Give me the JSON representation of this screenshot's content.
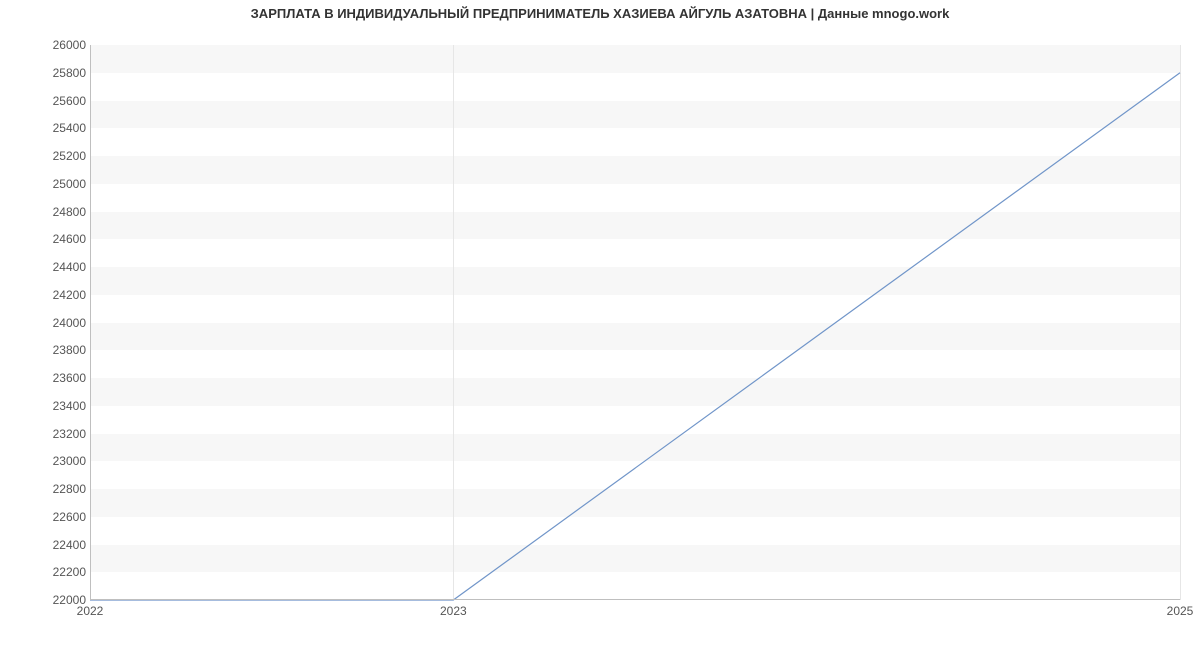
{
  "chart_data": {
    "type": "line",
    "title": "ЗАРПЛАТА В ИНДИВИДУАЛЬНЫЙ ПРЕДПРИНИМАТЕЛЬ ХАЗИЕВА АЙГУЛЬ АЗАТОВНА | Данные mnogo.work",
    "xlabel": "",
    "ylabel": "",
    "x": [
      2022,
      2023,
      2025
    ],
    "values": [
      22000,
      22000,
      25800
    ],
    "x_ticks": [
      2022,
      2023,
      2025
    ],
    "y_ticks": [
      22000,
      22200,
      22400,
      22600,
      22800,
      23000,
      23200,
      23400,
      23600,
      23800,
      24000,
      24200,
      24400,
      24600,
      24800,
      25000,
      25200,
      25400,
      25600,
      25800,
      26000
    ],
    "xlim": [
      2022,
      2025
    ],
    "ylim": [
      22000,
      26000
    ],
    "colors": {
      "line": "#7095c9",
      "grid_band": "#f7f7f7",
      "axis": "#bfbfbf"
    }
  }
}
